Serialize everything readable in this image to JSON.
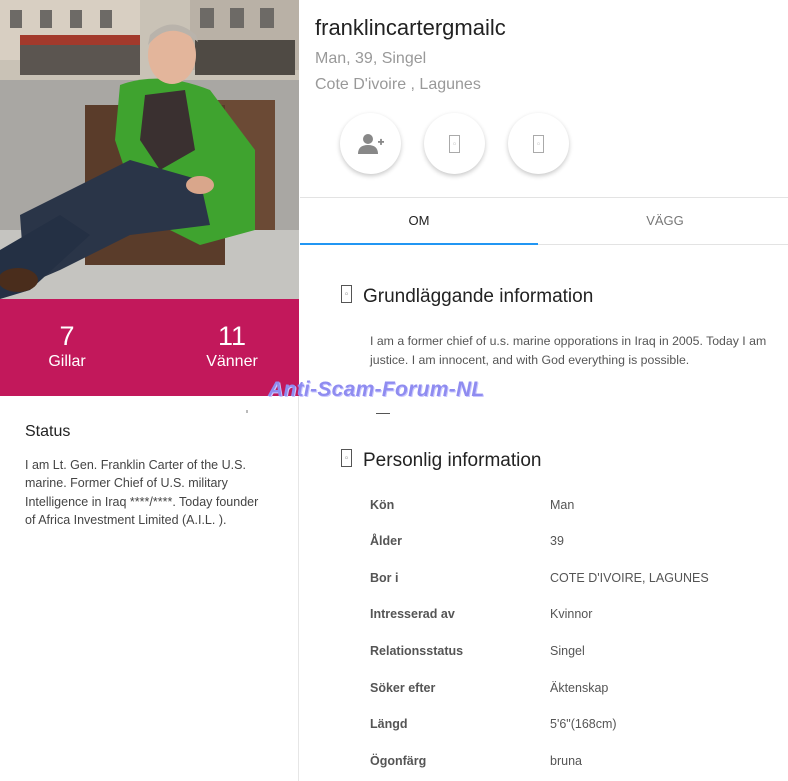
{
  "profile": {
    "username": "franklincartergmailc",
    "subline_1": "Man, 39, Singel",
    "subline_2": "Cote D'ivoire , Lagunes"
  },
  "stats": {
    "likes_count": "7",
    "likes_label": "Gillar",
    "friends_count": "11",
    "friends_label": "Vänner"
  },
  "status": {
    "title": "Status",
    "lines": [
      "I am Lt. Gen. Franklin Carter of the U.S.",
      "marine. Former Chief of U.S. military",
      "Intelligence in Iraq ****/****. Today founder",
      "of Africa Investment Limited (A.I.L. )."
    ]
  },
  "actions": {
    "add_friend": "add-friend-icon",
    "message": "message-icon",
    "favorite": "favorite-icon"
  },
  "tabs": [
    {
      "label": "OM",
      "active": true
    },
    {
      "label": "VÄGG",
      "active": false
    }
  ],
  "basic_info": {
    "title": "Grundläggande information",
    "bio_lines": [
      "I am a former chief of u.s. marine opporations in Iraq in 2005. Today I am",
      "justice. I am innocent, and with God everything is possible."
    ]
  },
  "personal_info": {
    "title": "Personlig information",
    "rows": [
      {
        "key": "Kön",
        "value": "Man"
      },
      {
        "key": "Ålder",
        "value": "39"
      },
      {
        "key": "Bor i",
        "value": "COTE D'IVOIRE, LAGUNES"
      },
      {
        "key": "Intresserad av",
        "value": "Kvinnor"
      },
      {
        "key": "Relationsstatus",
        "value": "Singel"
      },
      {
        "key": "Söker efter",
        "value": "Äktenskap"
      },
      {
        "key": "Längd",
        "value": "5'6\"(168cm)"
      },
      {
        "key": "Ögonfärg",
        "value": "bruna"
      }
    ]
  },
  "watermark": "Anti-Scam-Forum-NL",
  "colors": {
    "accent": "#c2185b",
    "tab_underline": "#2196f3",
    "watermark": "#8f8cf0"
  }
}
